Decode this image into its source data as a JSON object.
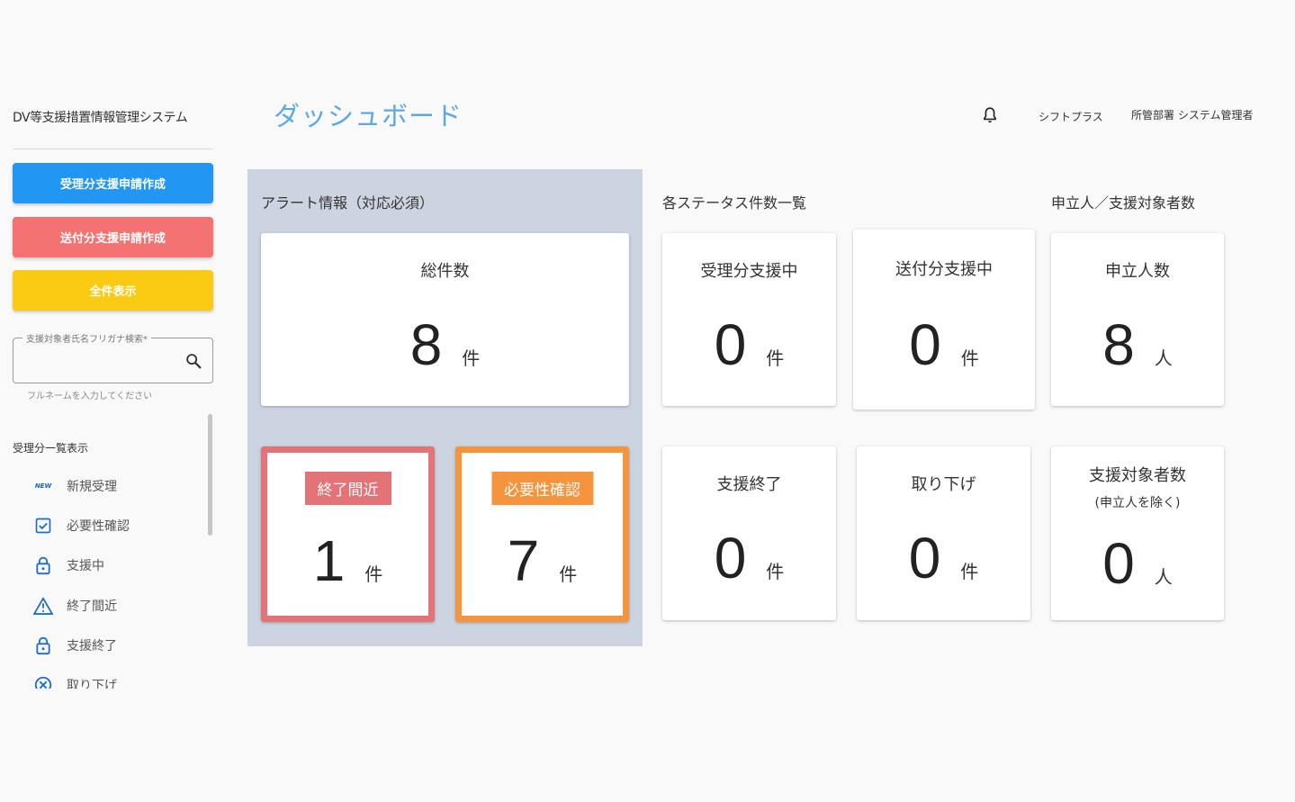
{
  "sidebar": {
    "app_title": "DV等支援措置情報管理システム",
    "buttons": {
      "received_create": "受理分支援申請作成",
      "sent_create": "送付分支援申請作成",
      "show_all": "全件表示"
    },
    "search": {
      "label": "支援対象者氏名フリガナ検索*",
      "value": "",
      "helper": "フルネームを入力してください"
    },
    "list_header": "受理分一覧表示",
    "items": [
      {
        "icon": "new-icon",
        "badge": "NEW",
        "label": "新規受理"
      },
      {
        "icon": "checkbox-icon",
        "label": "必要性確認"
      },
      {
        "icon": "lock-icon",
        "label": "支援中"
      },
      {
        "icon": "warning-icon",
        "label": "終了間近"
      },
      {
        "icon": "lock-icon",
        "label": "支援終了"
      },
      {
        "icon": "cancel-icon",
        "label": "取り下げ"
      }
    ]
  },
  "header": {
    "page_title": "ダッシュボード",
    "shift_plus": "シフトプラス",
    "dept_user": "所管部署 システム管理者"
  },
  "alerts": {
    "title": "アラート情報（対応必須）",
    "total": {
      "label": "総件数",
      "value": "8",
      "unit": "件"
    },
    "ending_soon": {
      "badge": "終了間近",
      "value": "1",
      "unit": "件"
    },
    "need_confirm": {
      "badge": "必要性確認",
      "value": "7",
      "unit": "件"
    }
  },
  "status": {
    "title": "各ステータス件数一覧",
    "received_support": {
      "label": "受理分支援中",
      "value": "0",
      "unit": "件"
    },
    "sent_support": {
      "label": "送付分支援中",
      "value": "0",
      "unit": "件"
    },
    "support_end": {
      "label": "支援終了",
      "value": "0",
      "unit": "件"
    },
    "withdrawn": {
      "label": "取り下げ",
      "value": "0",
      "unit": "件"
    }
  },
  "persons": {
    "title": "申立人／支援対象者数",
    "applicants": {
      "label": "申立人数",
      "value": "8",
      "unit": "人"
    },
    "targets": {
      "label": "支援対象者数",
      "sub": "(申立人を除く)",
      "value": "0",
      "unit": "人"
    }
  },
  "colors": {
    "primary": "#2196f3",
    "danger": "#f47272",
    "warning": "#fbcb14",
    "alert_red": "#e37376",
    "alert_orange": "#f6943d",
    "panel_bg": "#cbd4e0",
    "title_blue": "#5ca8e6"
  }
}
